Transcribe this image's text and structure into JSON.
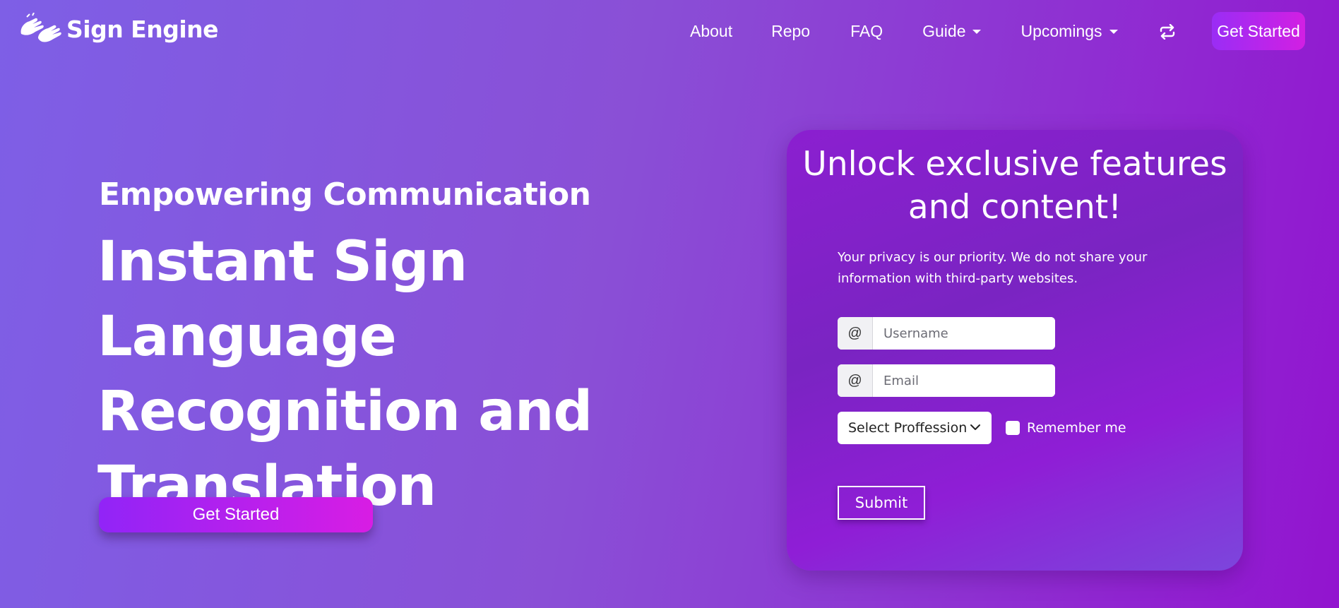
{
  "nav": {
    "brand": "Sign Engine",
    "brand_icon": "sign-hands-icon",
    "links": {
      "about": "About",
      "repo": "Repo",
      "faq": "FAQ",
      "guide": "Guide",
      "upcomings": "Upcomings"
    },
    "swap_icon": "swap-arrows-icon",
    "cta": "Get Started"
  },
  "hero": {
    "subtitle": "Empowering Communication",
    "title": "Instant Sign Language Recognition and Translation",
    "cta": "Get Started"
  },
  "card": {
    "title": "Unlock exclusive features and content!",
    "privacy": "Your privacy is our priority. We do not share your information with third-party websites.",
    "username": {
      "addon": "@",
      "placeholder": "Username"
    },
    "email": {
      "addon": "@",
      "placeholder": "Email"
    },
    "profession": {
      "selected": "Select Proffession"
    },
    "remember": "Remember me",
    "submit": "Submit"
  },
  "colors": {
    "accent_gradient_start": "#9124f7",
    "accent_gradient_end": "#d81de4"
  }
}
